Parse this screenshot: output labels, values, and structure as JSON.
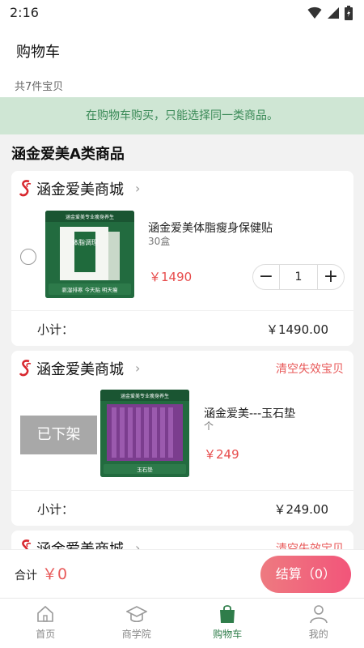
{
  "status_bar": {
    "time": "2:16"
  },
  "header": {
    "title": "购物车"
  },
  "cart": {
    "count_text": "共7件宝贝"
  },
  "notice": {
    "text": "在购物车购买，只能选择同一类商品。"
  },
  "section": {
    "title": "涵金爱美A类商品"
  },
  "shops": [
    {
      "name": "涵金爱美商城",
      "product": {
        "name": "涵金爱美体脂瘦身保健贴",
        "spec": "30盒",
        "price": "￥1490",
        "quantity": "1"
      },
      "thumb": {
        "top_text": "涵金爱美专业瘦身养生",
        "box_text": "体脂调理",
        "bottom_text": "驱湿排寒 今天贴 明天瘦"
      },
      "subtotal_label": "小计：",
      "subtotal_value": "￥1490.00"
    },
    {
      "name": "涵金爱美商城",
      "clear_label": "清空失效宝贝",
      "offshelf_label": "已下架",
      "product": {
        "name": "涵金爱美---玉石垫",
        "spec": "个",
        "price": "￥249"
      },
      "thumb": {
        "top_text": "涵金爱美专业瘦身养生",
        "bottom_text": "玉石垫"
      },
      "subtotal_label": "小计：",
      "subtotal_value": "￥249.00"
    },
    {
      "name": "涵金爱美商城",
      "clear_label": "清空失效宝贝"
    }
  ],
  "checkout": {
    "total_label": "合计",
    "total_value": "￥0",
    "button_label": "结算（0）"
  },
  "tabs": [
    {
      "label": "首页",
      "icon": "home-icon"
    },
    {
      "label": "商学院",
      "icon": "graduation-cap-icon"
    },
    {
      "label": "购物车",
      "icon": "shopping-bag-icon",
      "active": true
    },
    {
      "label": "我的",
      "icon": "user-icon"
    }
  ],
  "colors": {
    "brand_green": "#2f7d4a",
    "price_red": "#e74c4c",
    "notice_bg": "#cfe6d4"
  }
}
